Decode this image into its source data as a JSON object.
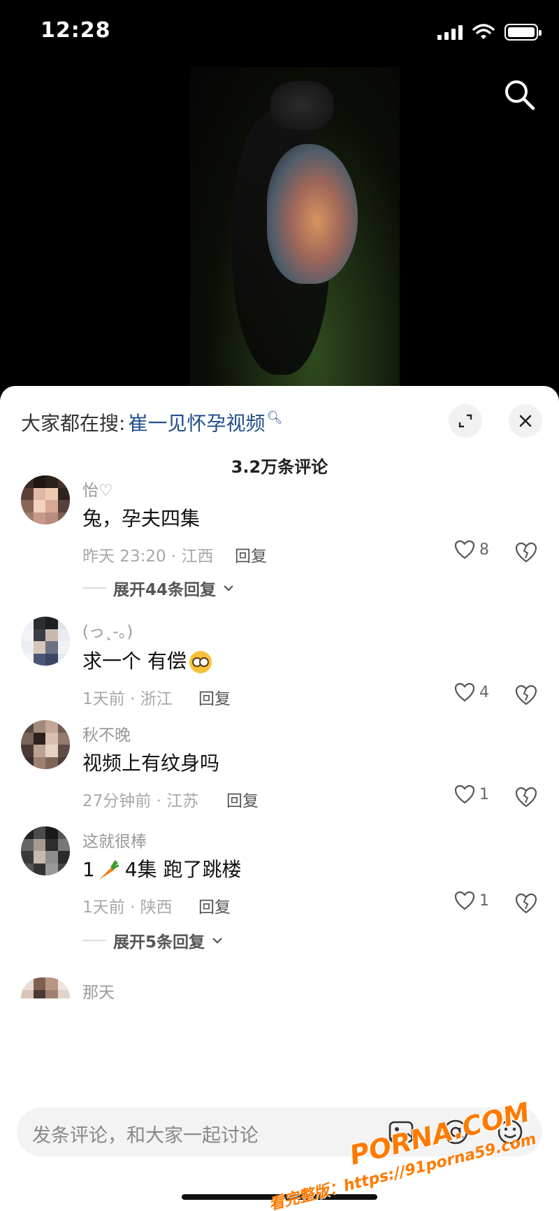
{
  "status_bar": {
    "time": "12:28"
  },
  "search_bar": {
    "prefix": "大家都在搜:",
    "term": "崔一见怀孕视频"
  },
  "comments_header": {
    "count": "3.2万条评论"
  },
  "comments": [
    {
      "username": "怡♡",
      "text": "兔，孕夫四集",
      "time_location": "昨天 23:20 · 江西",
      "reply": "回复",
      "likes": "8",
      "expand": "展开44条回复"
    },
    {
      "username": "(っ˛-。)",
      "text": "求一个 有偿",
      "time_location": "1天前 · 浙江",
      "reply": "回复",
      "likes": "4"
    },
    {
      "username": "秋不晚",
      "text": "视频上有纹身吗",
      "time_location": "27分钟前 · 江苏",
      "reply": "回复",
      "likes": "1"
    },
    {
      "username": "这就很棒",
      "text_prefix": "1",
      "text_suffix": " 4集 跑了跳楼",
      "time_location": "1天前 · 陕西",
      "reply": "回复",
      "likes": "1",
      "expand": "展开5条回复"
    },
    {
      "username": "那天"
    }
  ],
  "input": {
    "placeholder": "发条评论，和大家一起讨论"
  },
  "watermark": {
    "brand": "PORNA.COM",
    "url": "看完整版：https://91porna59.com"
  },
  "colors": {
    "accent_link": "#1f4e8c",
    "watermark": "#ff7a00"
  }
}
